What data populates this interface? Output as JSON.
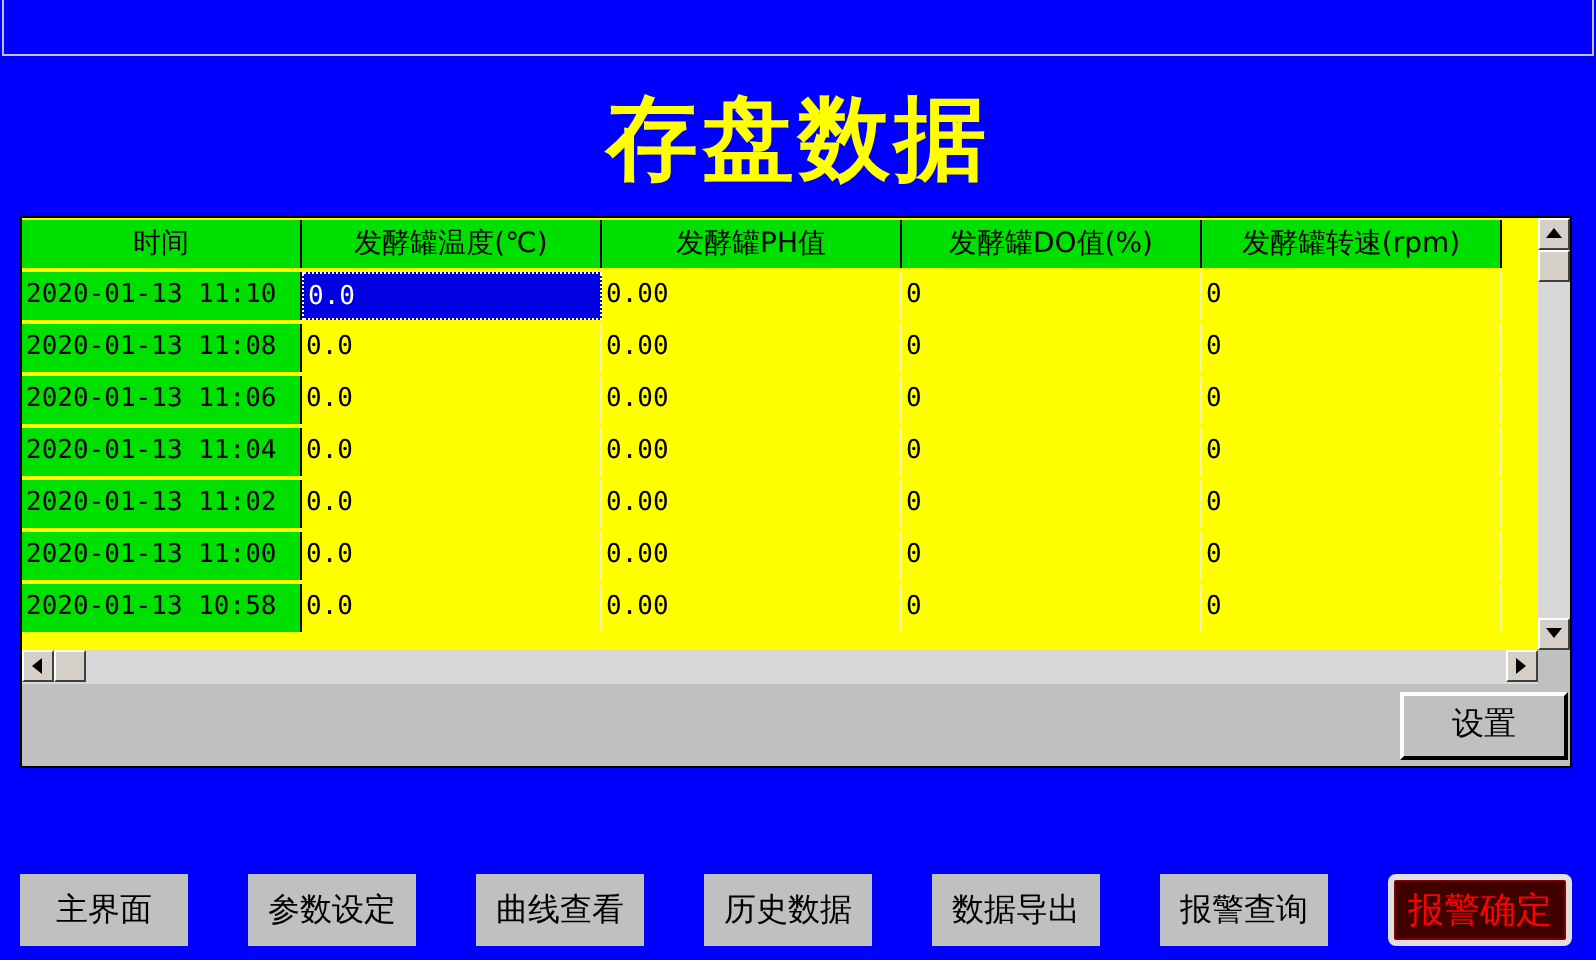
{
  "title": "存盘数据",
  "table": {
    "columns": [
      "时间",
      "发酵罐温度(℃)",
      "发酵罐PH值",
      "发酵罐DO值(%)",
      "发酵罐转速(rpm)"
    ],
    "rows": [
      {
        "cells": [
          {
            "text": "2020-01-13 11:10",
            "selected": false
          },
          {
            "text": "0.0",
            "selected": true
          },
          {
            "text": "0.00",
            "selected": false
          },
          {
            "text": "0",
            "selected": false
          },
          {
            "text": "0",
            "selected": false
          }
        ]
      },
      {
        "cells": [
          {
            "text": "2020-01-13 11:08",
            "selected": false
          },
          {
            "text": "0.0",
            "selected": false
          },
          {
            "text": "0.00",
            "selected": false
          },
          {
            "text": "0",
            "selected": false
          },
          {
            "text": "0",
            "selected": false
          }
        ]
      },
      {
        "cells": [
          {
            "text": "2020-01-13 11:06",
            "selected": false
          },
          {
            "text": "0.0",
            "selected": false
          },
          {
            "text": "0.00",
            "selected": false
          },
          {
            "text": "0",
            "selected": false
          },
          {
            "text": "0",
            "selected": false
          }
        ]
      },
      {
        "cells": [
          {
            "text": "2020-01-13 11:04",
            "selected": false
          },
          {
            "text": "0.0",
            "selected": false
          },
          {
            "text": "0.00",
            "selected": false
          },
          {
            "text": "0",
            "selected": false
          },
          {
            "text": "0",
            "selected": false
          }
        ]
      },
      {
        "cells": [
          {
            "text": "2020-01-13 11:02",
            "selected": false
          },
          {
            "text": "0.0",
            "selected": false
          },
          {
            "text": "0.00",
            "selected": false
          },
          {
            "text": "0",
            "selected": false
          },
          {
            "text": "0",
            "selected": false
          }
        ]
      },
      {
        "cells": [
          {
            "text": "2020-01-13 11:00",
            "selected": false
          },
          {
            "text": "0.0",
            "selected": false
          },
          {
            "text": "0.00",
            "selected": false
          },
          {
            "text": "0",
            "selected": false
          },
          {
            "text": "0",
            "selected": false
          }
        ]
      },
      {
        "cells": [
          {
            "text": "2020-01-13 10:58",
            "selected": false
          },
          {
            "text": "0.0",
            "selected": false
          },
          {
            "text": "0.00",
            "selected": false
          },
          {
            "text": "0",
            "selected": false
          },
          {
            "text": "0",
            "selected": false
          }
        ]
      }
    ]
  },
  "settings_button": "设置",
  "nav_buttons": [
    {
      "label": "主界面",
      "kind": "nav"
    },
    {
      "label": "参数设定",
      "kind": "nav"
    },
    {
      "label": "曲线查看",
      "kind": "nav"
    },
    {
      "label": "历史数据",
      "kind": "nav"
    },
    {
      "label": "数据导出",
      "kind": "nav"
    },
    {
      "label": "报警查询",
      "kind": "nav"
    },
    {
      "label": "报警确定",
      "kind": "alarm"
    }
  ]
}
